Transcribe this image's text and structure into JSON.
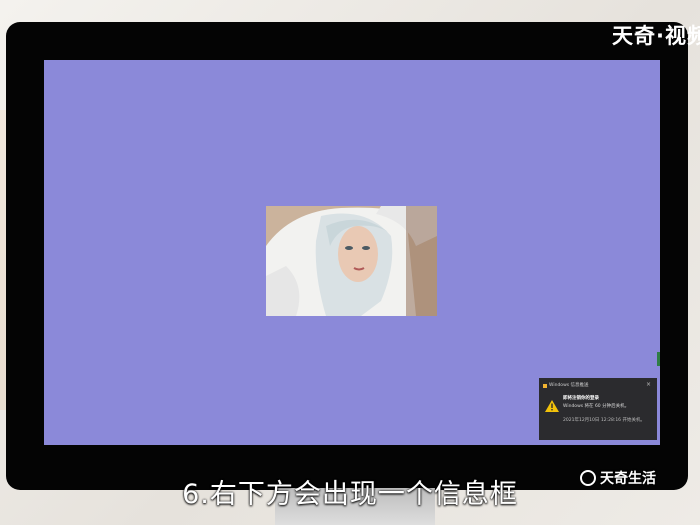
{
  "watermark_top": "天奇·视频",
  "caption": "6.右下方会出现一个信息框",
  "logo": {
    "text": "天奇生活"
  },
  "notification": {
    "app_name": "Windows 信息推送",
    "close_symbol": "×",
    "title": "即将注销你的登录",
    "body": "Windows 将在 60 分钟后关机。",
    "time": "2021年12月10日 12:28:16 开始关机。",
    "icon": "warning-icon"
  },
  "colors": {
    "desktop": "#8b89d9",
    "bezel": "#040404",
    "toast_bg": "#2b2b2e",
    "warning": "#f2c20a"
  }
}
